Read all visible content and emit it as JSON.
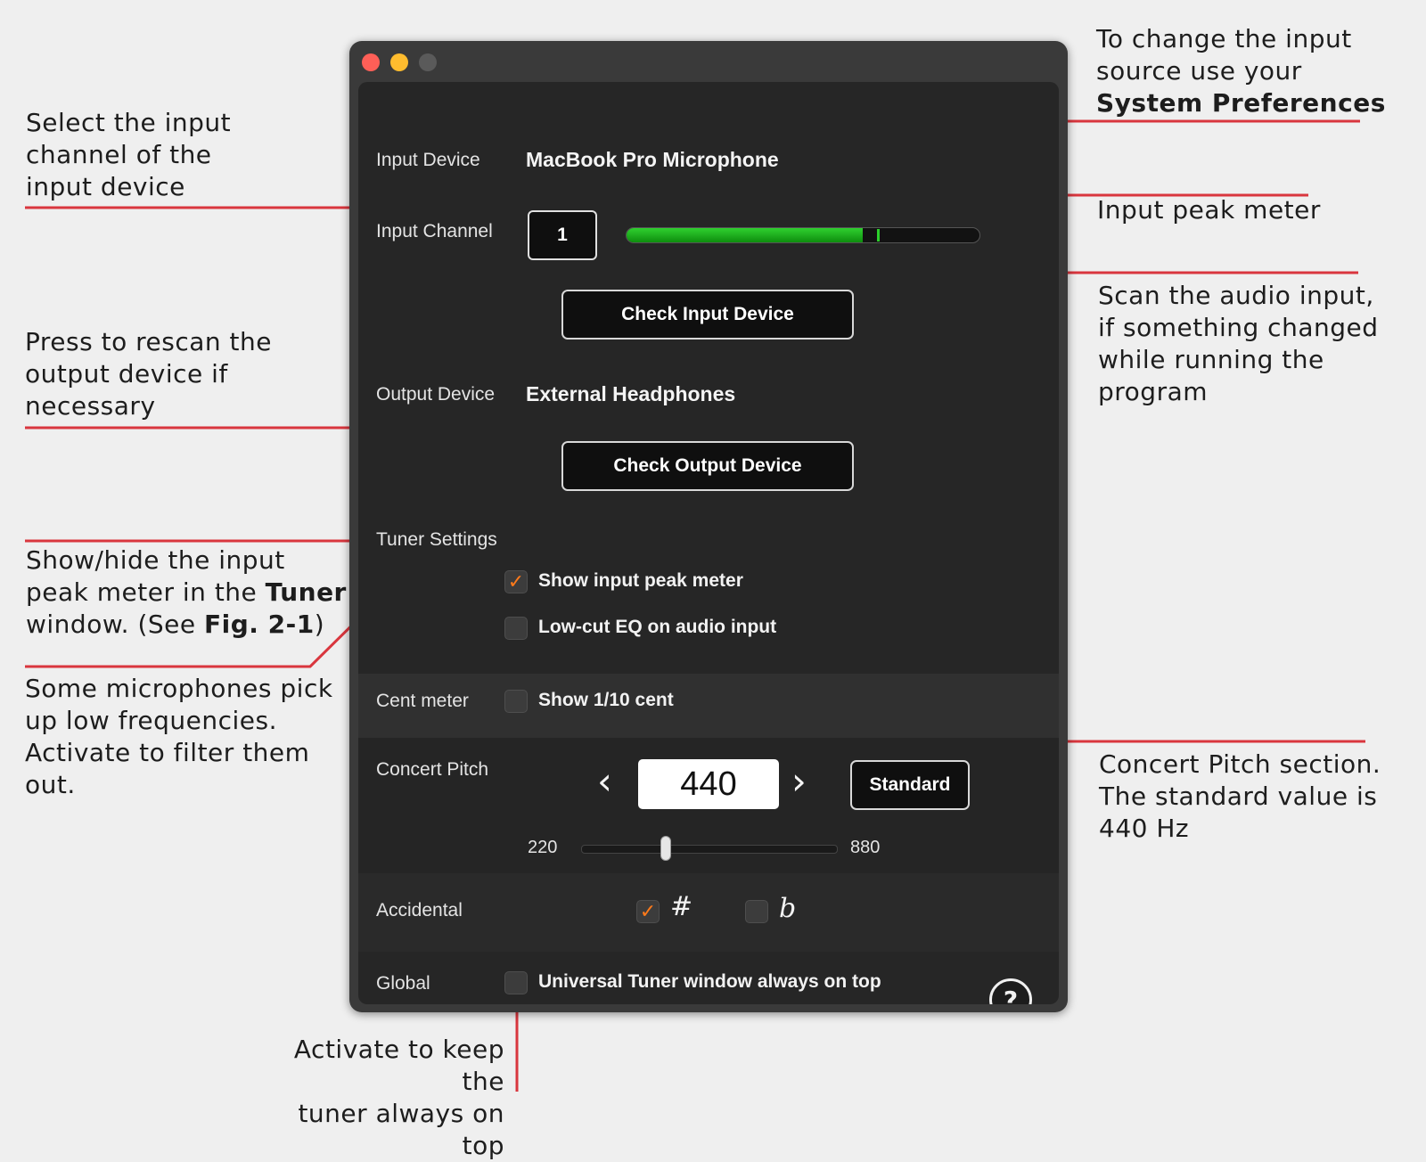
{
  "annotations": {
    "input_channel": [
      "Select the input",
      "channel of the",
      "input device"
    ],
    "input_source": [
      "To change the input",
      "source use your"
    ],
    "input_source_bold": "System Preferences",
    "peak_meter": "Input peak meter",
    "scan_input": [
      "Scan the audio input,",
      "if something changed",
      "while running the",
      "program"
    ],
    "rescan_output": [
      "Press to rescan the",
      "output device if",
      "necessary"
    ],
    "show_hide_1": "Show/hide the input",
    "show_hide_2a": "peak meter in the ",
    "show_hide_2b": "Tuner",
    "show_hide_3a": "window. (See ",
    "show_hide_3b": "Fig. 2-1",
    "show_hide_3c": ")",
    "low_cut": [
      "Some microphones pick",
      "up low frequencies.",
      "Activate to filter them",
      "out."
    ],
    "concert_pitch": [
      "Concert Pitch section.",
      "The standard value is",
      "440 Hz"
    ],
    "always_on_top": [
      "Activate to keep the",
      "tuner always on top"
    ]
  },
  "window": {
    "input_device_label": "Input Device",
    "input_device_value": "MacBook Pro Microphone",
    "input_channel_label": "Input Channel",
    "input_channel_value": "1",
    "input_level": 0.67,
    "input_peak": 0.71,
    "check_input_button": "Check Input Device",
    "output_device_label": "Output Device",
    "output_device_value": "External Headphones",
    "check_output_button": "Check Output Device",
    "tuner_settings_label": "Tuner Settings",
    "show_peak_meter": "Show input peak meter",
    "low_cut_eq": "Low-cut EQ on audio input",
    "cent_meter_label": "Cent meter",
    "show_tenth_cent": "Show 1/10 cent",
    "concert_pitch_label": "Concert Pitch",
    "pitch_value": "440",
    "pitch_prev": "‹",
    "pitch_next": "›",
    "standard_button": "Standard",
    "slider_min": "220",
    "slider_max": "880",
    "slider_value": 440,
    "accidental_label": "Accidental",
    "sharp_symbol": "#",
    "flat_symbol": "b",
    "global_label": "Global",
    "always_on_top_label": "Universal Tuner window always on top",
    "help_symbol": "?",
    "check_mark": "✓"
  },
  "colors": {
    "annotation_line": "#d9363e",
    "check_orange": "#ff7a1a",
    "meter_green": "#2fd12f"
  }
}
